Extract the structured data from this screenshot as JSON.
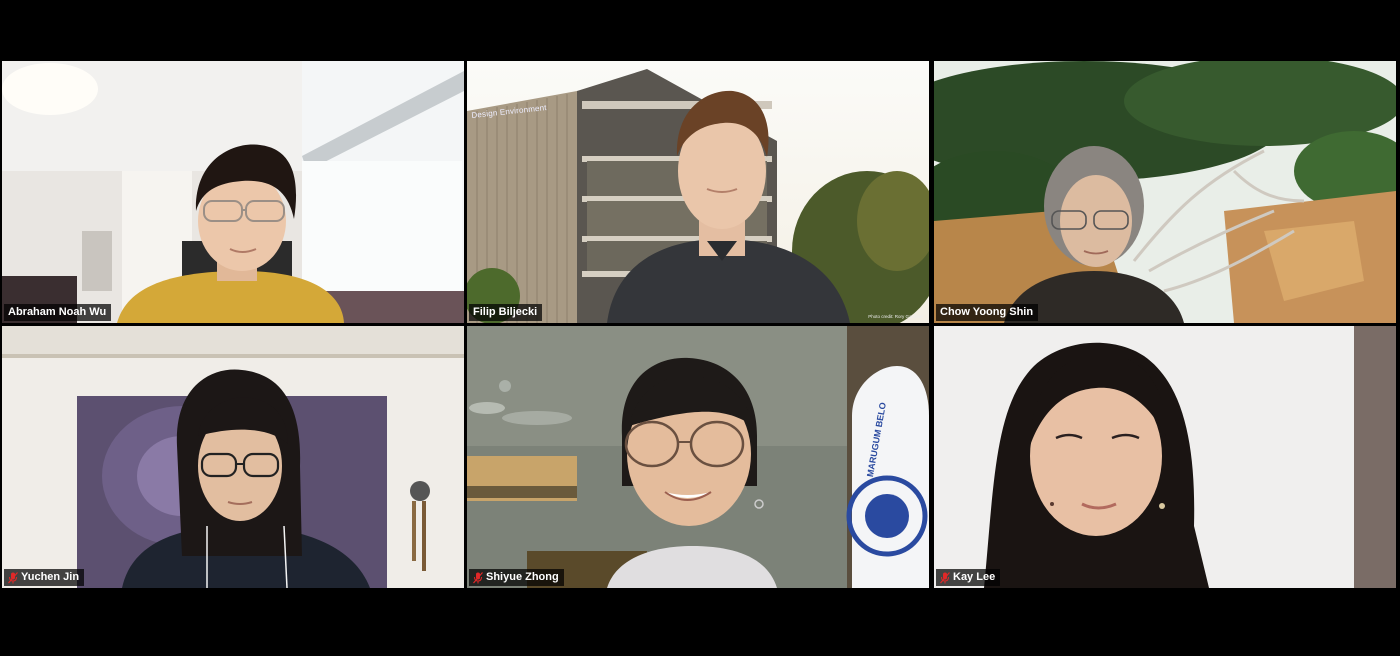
{
  "meeting": {
    "participants": [
      {
        "name": "Abraham Noah Wu",
        "muted": false,
        "active_speaker": false
      },
      {
        "name": "Filip Biljecki",
        "muted": false,
        "active_speaker": true
      },
      {
        "name": "Chow Yoong Shin",
        "muted": false,
        "active_speaker": false
      },
      {
        "name": "Yuchen Jin",
        "muted": true,
        "active_speaker": false
      },
      {
        "name": "Shiyue Zhong",
        "muted": true,
        "active_speaker": false
      },
      {
        "name": "Kay Lee",
        "muted": true,
        "active_speaker": false
      }
    ],
    "backgrounds": {
      "building_sign": "Design Environment",
      "photo_credit": "Photo credit: Rory Gardiner",
      "tote_bag_text": "MARUGUM BELO"
    }
  },
  "colors": {
    "active_border": "#d9e58a",
    "mute_icon": "#e02828",
    "name_tag_bg": "#000000b8"
  },
  "icons": {
    "mute": "microphone-muted-icon"
  }
}
